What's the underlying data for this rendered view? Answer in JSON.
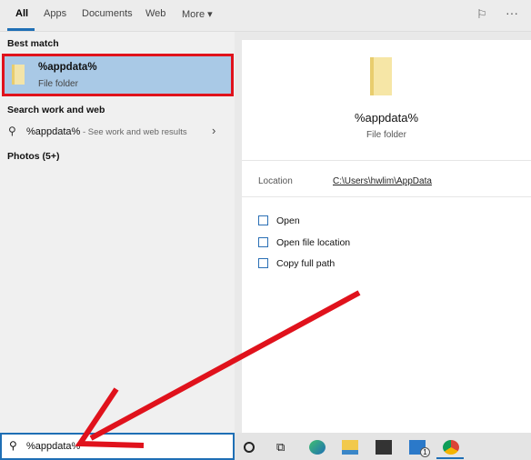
{
  "tabs": [
    "All",
    "Apps",
    "Documents",
    "Web",
    "More"
  ],
  "left": {
    "best_match": "Best match",
    "result": {
      "title": "%appdata%",
      "subtitle": "File folder",
      "icon": "folder-icon"
    },
    "search_web_heading": "Search work and web",
    "web_query": "%appdata%",
    "web_hint": "- See work and web results",
    "photos": "Photos (5+)"
  },
  "detail": {
    "title": "%appdata%",
    "subtitle": "File folder",
    "location_label": "Location",
    "location_value": "C:\\Users\\hwlim\\AppData",
    "actions": [
      "Open",
      "Open file location",
      "Copy full path"
    ]
  },
  "search": {
    "value": "%appdata%"
  },
  "taskbar": {
    "mail_badge": "1",
    "icons": [
      "cortana-icon",
      "task-view-icon",
      "edge-icon",
      "file-explorer-icon",
      "store-icon",
      "mail-icon",
      "chrome-icon"
    ]
  },
  "colors": {
    "accent": "#1f6fb5",
    "highlight": "#a9c9e6",
    "annotation": "#e0121c"
  }
}
